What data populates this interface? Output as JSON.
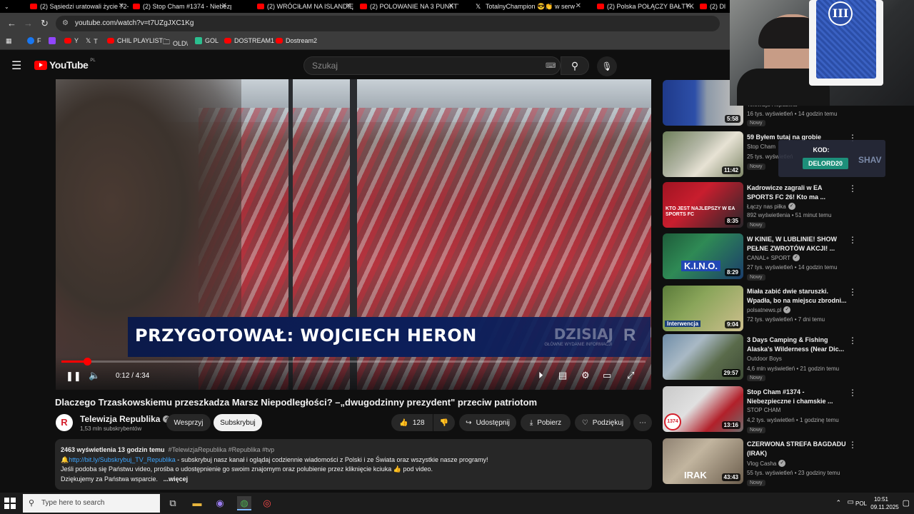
{
  "browser": {
    "tabs": [
      {
        "title": "(2) Sąsiedzi uratowali życie 72-l"
      },
      {
        "title": "(2) Stop Cham #1374 - Niebezpi"
      },
      {
        "title": "(2) WRÓCIŁAM NA ISLANDIĘ | ..."
      },
      {
        "title": "(2) POLOWANIE NA 3 PUNKTY |..."
      },
      {
        "title": "TotalnyChampion 😎👏 w serw"
      },
      {
        "title": "(2) Polska POŁĄCZY BAŁTYK z ..."
      },
      {
        "title": "(2) Dl"
      }
    ],
    "url": "youtube.com/watch?v=t7UZgJXC1Kg",
    "bookmarks": [
      {
        "label": "F",
        "icon": "facebook-icon"
      },
      {
        "label": "",
        "icon": "twitch-icon"
      },
      {
        "label": "Y",
        "icon": "youtube-icon"
      },
      {
        "label": "T",
        "icon": "x-icon"
      },
      {
        "label": "CHIL PLAYLIST",
        "icon": "youtube-icon"
      },
      {
        "label": "OLD\\",
        "icon": "folder-icon"
      },
      {
        "label": "GOL",
        "icon": "gol-icon"
      },
      {
        "label": "DOSTREAM1",
        "icon": "youtube-icon"
      },
      {
        "label": "Dostream2",
        "icon": "youtube-icon"
      }
    ]
  },
  "youtube": {
    "logo_text": "YouTube",
    "region": "PL",
    "search_placeholder": "Szukaj"
  },
  "video": {
    "overlay_text": "PRZYGOTOWAŁ: WOJCIECH HERON",
    "overlay_brand": "DZISIAJ",
    "overlay_brand_sub": "GŁÓWNE WYDANIE INFORMACJI",
    "time": "0:12 / 4:34",
    "progress": 0.044,
    "title": "Dlaczego Trzaskowskiemu przeszkadza Marsz Niepodległości? –„dwugodzinny prezydent\" przeciw patriotom",
    "channel": "Telewizja Republika",
    "subscribers": "1,53 mln subskrybentów",
    "join": "Wesprzyj",
    "subscribe": "Subskrybuj",
    "likes": "128",
    "share": "Udostępnij",
    "download": "Pobierz",
    "thanks": "Podziękuj"
  },
  "description": {
    "stats": "2463 wyświetlenia  13 godzin temu",
    "tags": "#TelewizjaRepublika #Republika #tvp",
    "link": "http://bit.ly/Subskrybuj_TV_Republika",
    "line1": " - subskrybuj nasz kanał i oglądaj codziennie wiadomości z Polski i ze Świata oraz wszystkie nasze programy!",
    "line2": "Jeśli podoba się Państwu video, prośba o udostępnienie go swoim znajomym oraz polubienie przez kliknięcie kciuka 👍 pod video.",
    "line3": "Dziękujemy za Państwa wsparcie.",
    "more": "...więcej"
  },
  "sidebar": [
    {
      "title": "",
      "channel": "Telewizja Republika",
      "meta": "16 tys. wyświetleń • 14 godzin temu",
      "badge": "Nowy",
      "duration": "5:58"
    },
    {
      "title": "59 Byłem tutaj na grobie",
      "channel": "Stop Cham",
      "meta": "25 tys. wyświetleń",
      "badge": "Nowy",
      "duration": "11:42"
    },
    {
      "title": "Kadrowicze zagrali w EA SPORTS FC 26! Kto ma ...",
      "channel": "Łączy nas piłka",
      "meta": "892 wyświetlenia • 51 minut temu",
      "badge": "Nowy",
      "duration": "8:35"
    },
    {
      "title": "W KINIE, W LUBLINIE! SHOW PEŁNE ZWROTÓW AKCJI! ...",
      "channel": "CANAL+ SPORT",
      "meta": "27 tys. wyświetleń • 14 godzin temu",
      "badge": "Nowy",
      "duration": "8:29"
    },
    {
      "title": "Miała zabić dwie staruszki. Wpadła, bo na miejscu zbrodni...",
      "channel": "polsatnews.pl",
      "meta": "72 tys. wyświetleń • 7 dni temu",
      "badge": "",
      "duration": "9:04"
    },
    {
      "title": "3 Days Camping & Fishing Alaska's Wilderness (Near Dic...",
      "channel": "Outdoor Boys",
      "meta": "4,6 mln wyświetleń • 21 godzin temu",
      "badge": "Nowy",
      "duration": "29:57"
    },
    {
      "title": "Stop Cham #1374 - Niebezpieczne i chamskie ...",
      "channel": "STOP CHAM",
      "meta": "4,2 tys. wyświetleń • 1 godzinę temu",
      "badge": "Nowy",
      "duration": "13:16"
    },
    {
      "title": "CZERWONA STREFA BAGDADU (IRAK)",
      "channel": "Vlog Casha",
      "meta": "55 tys. wyświetleń • 23 godziny temu",
      "badge": "Nowy",
      "duration": "43:43"
    }
  ],
  "thumb_labels": {
    "t3": "KTO JEST NAJLEPSZY W EA SPORTS FC",
    "t4": "K.I.N.O.",
    "t5": "Interwencja",
    "t7": "1374",
    "t8": "IRAK"
  },
  "stream_overlay": {
    "card_numeral": "III",
    "kod_label": "KOD:",
    "kod_value": "DELORD20",
    "kod_logo": "SHAV"
  },
  "taskbar": {
    "search_placeholder": "Type here to search",
    "lang": "POL",
    "time": "10:51",
    "date": "09.11.2025"
  },
  "colors": {
    "yt_red": "#ff0000",
    "bg": "#0f0f0f",
    "link": "#3ea6ff",
    "lower_third": "#0c1f5b"
  }
}
